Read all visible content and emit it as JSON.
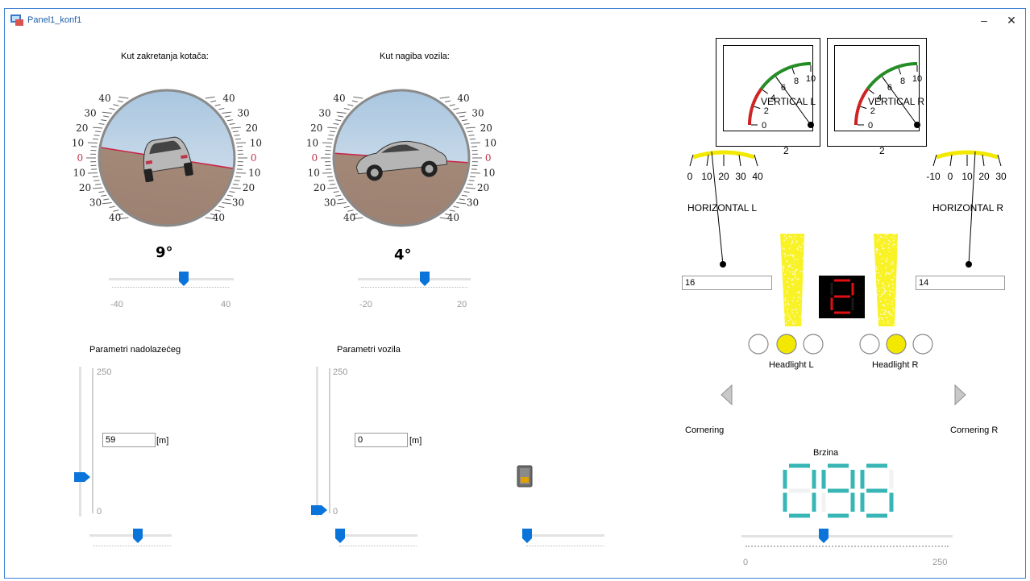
{
  "window": {
    "title": "Panel1_konf1",
    "minimize": "–",
    "close": "✕"
  },
  "attitude": {
    "wheel": {
      "title": "Kut zakretanja kotača:",
      "value": "9°",
      "slider_min": "-40",
      "slider_max": "40",
      "slider_value": 9
    },
    "tilt": {
      "title": "Kut nagiba vozila:",
      "value": "4°",
      "slider_min": "-20",
      "slider_max": "20",
      "slider_value": 4
    },
    "scale_left": [
      "40",
      "30",
      "20",
      "10",
      "0",
      "10",
      "20",
      "30",
      "40"
    ],
    "scale_right": [
      "40",
      "30",
      "20",
      "10",
      "0",
      "10",
      "20",
      "30",
      "40"
    ]
  },
  "oncoming": {
    "title": "Parametri nadolazećeg",
    "max": "250",
    "min": "0",
    "distance": "59",
    "unit": "[m]",
    "level": 59
  },
  "vehicle": {
    "title": "Parametri vozila",
    "max": "250",
    "min": "0",
    "distance": "0",
    "unit": "[m]",
    "level": 0
  },
  "vertical_l": {
    "label": "VERTICAL L",
    "ticks": [
      "0",
      "2",
      "4",
      "6",
      "8",
      "10"
    ],
    "value": "2"
  },
  "vertical_r": {
    "label": "VERTICAL R",
    "ticks": [
      "0",
      "2",
      "4",
      "6",
      "8",
      "10"
    ],
    "value": "2"
  },
  "horizontal_l": {
    "label": "HORIZONTAL L",
    "ticks": [
      "0",
      "10",
      "20",
      "30",
      "40"
    ],
    "field": "16"
  },
  "horizontal_r": {
    "label": "HORIZONTAL R",
    "ticks": [
      "-10",
      "0",
      "10",
      "20",
      "30"
    ],
    "field": "14"
  },
  "gear_digit": "2",
  "headlight_l": {
    "label": "Headlight L"
  },
  "headlight_r": {
    "label": "Headlight R"
  },
  "cornering_l": "Cornering",
  "cornering_r": "Cornering R",
  "speed": {
    "label": "Brzina",
    "value": "096",
    "slider_min": "0",
    "slider_max": "250",
    "slider_value": 96
  },
  "colors": {
    "accent": "#0a74da",
    "lcd": "#38b5b5",
    "lamp": "#f2e800",
    "window_border": "#3c7fd1"
  }
}
